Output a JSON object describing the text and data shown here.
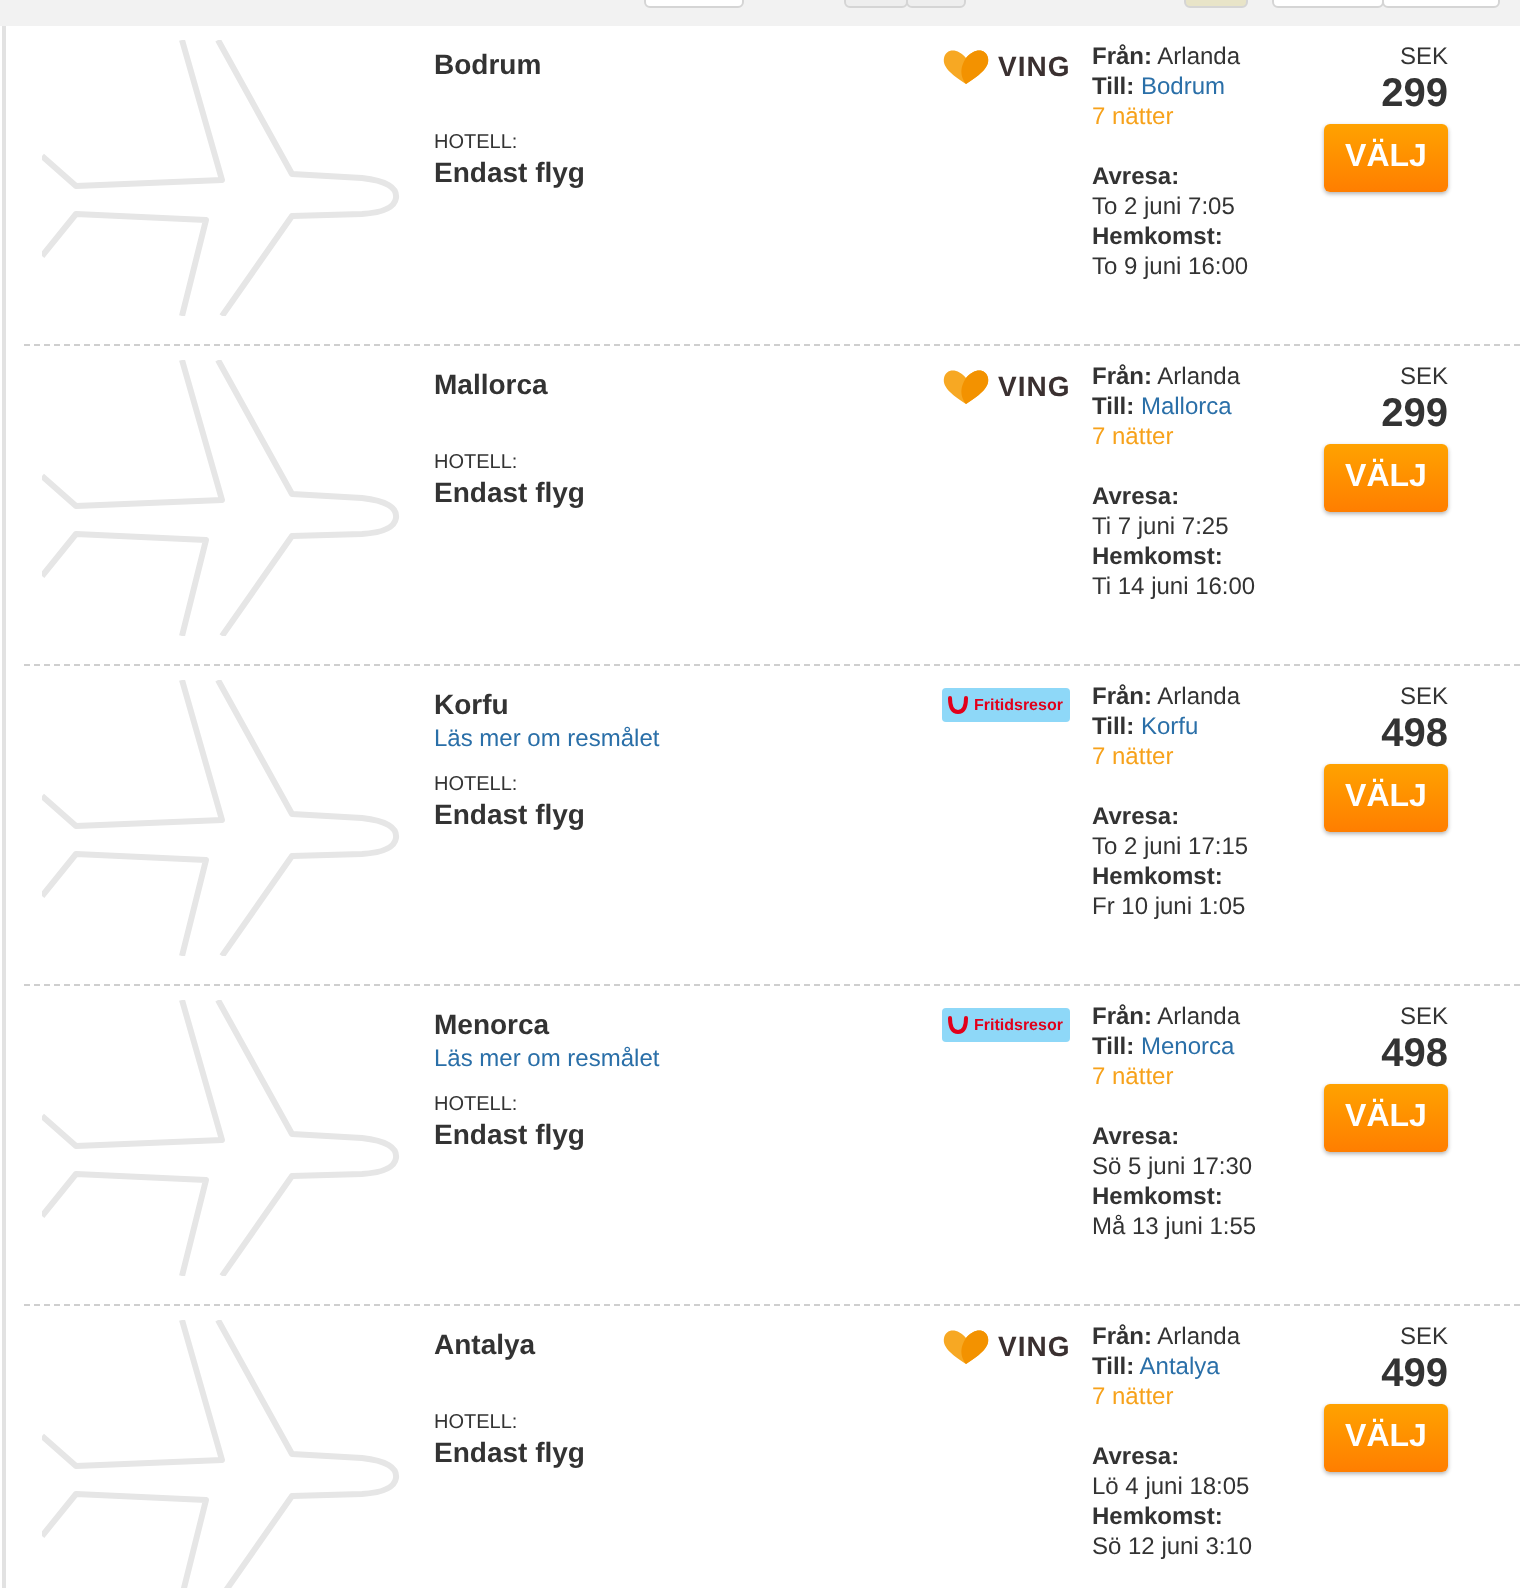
{
  "offers": [
    {
      "destination": "Bodrum",
      "hotel_label": "HOTELL:",
      "hotel": "Endast flyg",
      "logo": {
        "kind": "ving",
        "text": "VING"
      },
      "from_label": "Från:",
      "from": "Arlanda",
      "to_label": "Till:",
      "to": "Bodrum",
      "nights": "7 nätter",
      "depart_label": "Avresa:",
      "depart": "To 2 juni 7:05",
      "return_label": "Hemkomst:",
      "return": "To 9 juni 16:00",
      "currency": "SEK",
      "price": "299",
      "button": "VÄLJ"
    },
    {
      "destination": "Mallorca",
      "hotel_label": "HOTELL:",
      "hotel": "Endast flyg",
      "logo": {
        "kind": "ving",
        "text": "VING"
      },
      "from_label": "Från:",
      "from": "Arlanda",
      "to_label": "Till:",
      "to": "Mallorca",
      "nights": "7 nätter",
      "depart_label": "Avresa:",
      "depart": "Ti 7 juni 7:25",
      "return_label": "Hemkomst:",
      "return": "Ti 14 juni 16:00",
      "currency": "SEK",
      "price": "299",
      "button": "VÄLJ"
    },
    {
      "destination": "Korfu",
      "more_link": "Läs mer om resmålet",
      "hotel_label": "HOTELL:",
      "hotel": "Endast flyg",
      "logo": {
        "kind": "fritidsresor",
        "text": "Fritidsresor"
      },
      "from_label": "Från:",
      "from": "Arlanda",
      "to_label": "Till:",
      "to": "Korfu",
      "nights": "7 nätter",
      "depart_label": "Avresa:",
      "depart": "To 2 juni 17:15",
      "return_label": "Hemkomst:",
      "return": "Fr 10 juni 1:05",
      "currency": "SEK",
      "price": "498",
      "button": "VÄLJ"
    },
    {
      "destination": "Menorca",
      "more_link": "Läs mer om resmålet",
      "hotel_label": "HOTELL:",
      "hotel": "Endast flyg",
      "logo": {
        "kind": "fritidsresor",
        "text": "Fritidsresor"
      },
      "from_label": "Från:",
      "from": "Arlanda",
      "to_label": "Till:",
      "to": "Menorca",
      "nights": "7 nätter",
      "depart_label": "Avresa:",
      "depart": "Sö 5 juni 17:30",
      "return_label": "Hemkomst:",
      "return": "Må 13 juni 1:55",
      "currency": "SEK",
      "price": "498",
      "button": "VÄLJ"
    },
    {
      "destination": "Antalya",
      "hotel_label": "HOTELL:",
      "hotel": "Endast flyg",
      "logo": {
        "kind": "ving",
        "text": "VING"
      },
      "from_label": "Från:",
      "from": "Arlanda",
      "to_label": "Till:",
      "to": "Antalya",
      "nights": "7 nätter",
      "depart_label": "Avresa:",
      "depart": "Lö 4 juni 18:05",
      "return_label": "Hemkomst:",
      "return": "Sö 12 juni 3:10",
      "currency": "SEK",
      "price": "499",
      "button": "VÄLJ"
    }
  ]
}
